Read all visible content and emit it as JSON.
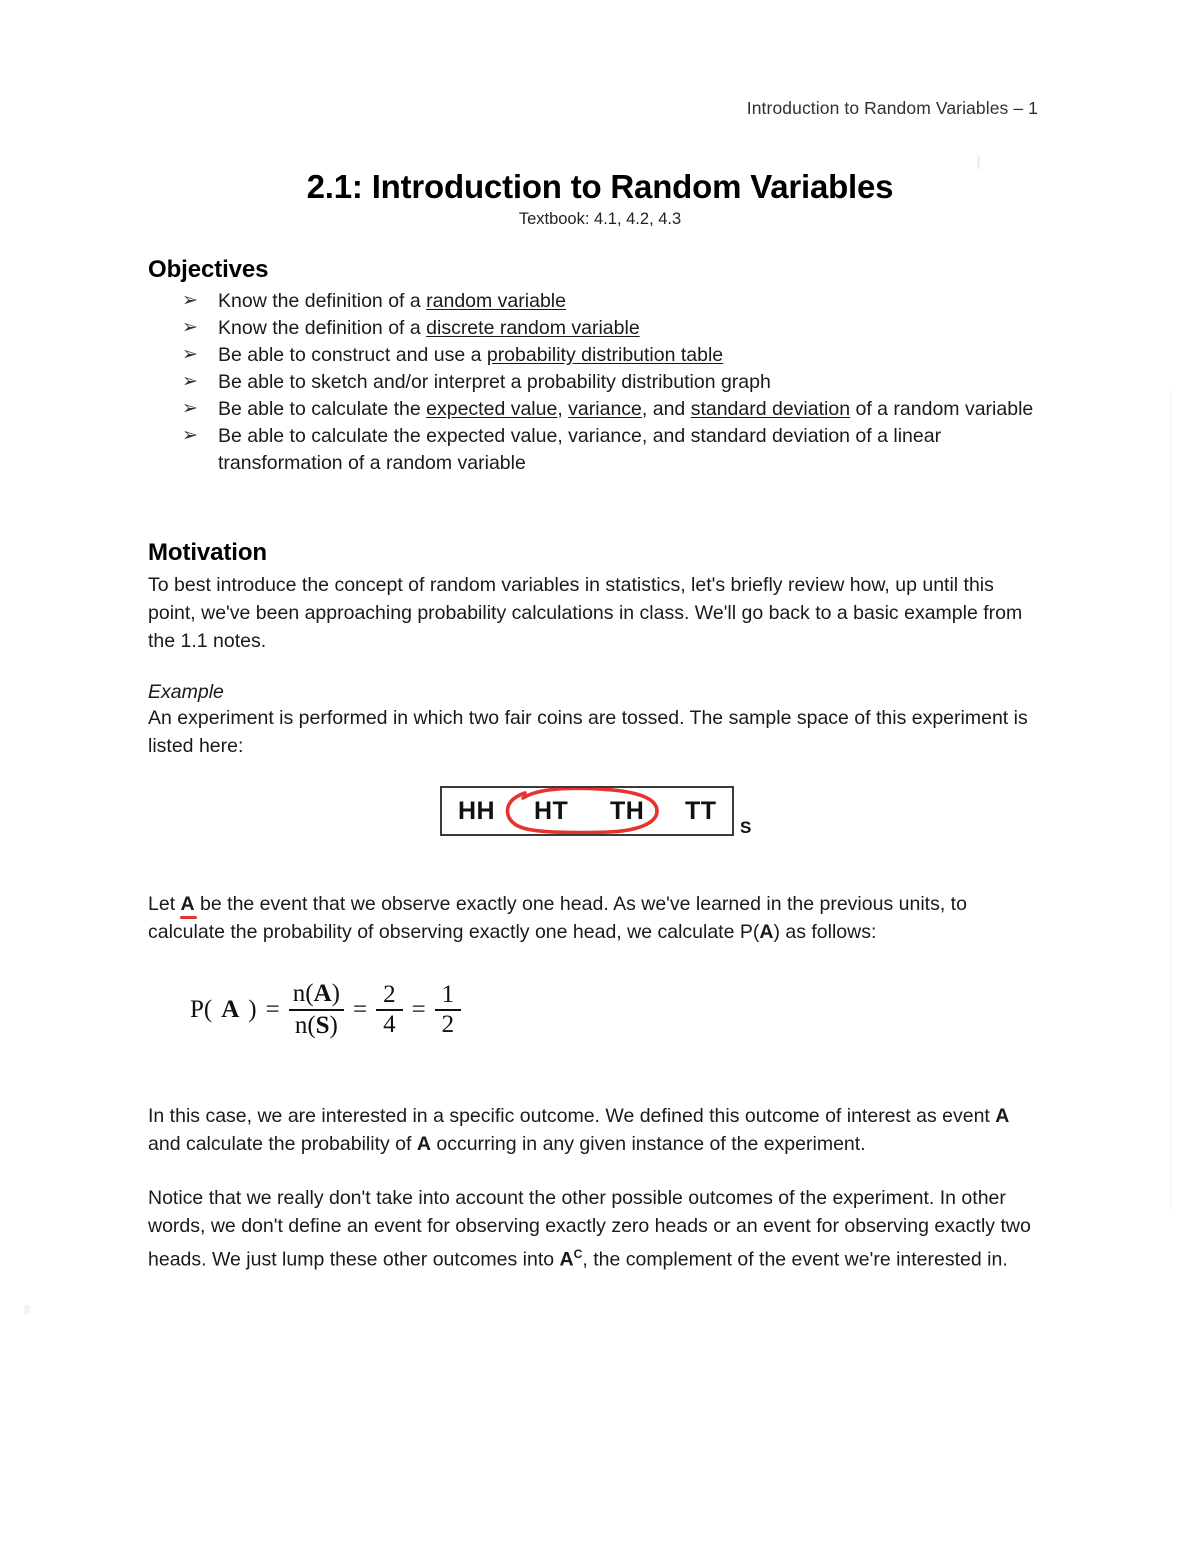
{
  "header": {
    "running_head": "Introduction to Random Variables – 1"
  },
  "title": {
    "main": "2.1: Introduction to Random Variables",
    "subtitle": "Textbook: 4.1, 4.2, 4.3"
  },
  "objectives": {
    "heading": "Objectives",
    "bullet_glyph": "➢",
    "items": [
      {
        "pre": "Know the definition of a ",
        "underlined": "random variable",
        "post": ""
      },
      {
        "pre": "Know the definition of a ",
        "underlined": "discrete random variable",
        "post": ""
      },
      {
        "pre": "Be able to construct and use a ",
        "underlined": "probability distribution table",
        "post": ""
      },
      {
        "pre": "Be able to sketch and/or interpret a probability distribution graph",
        "underlined": "",
        "post": ""
      },
      {
        "pre": "Be able to calculate the ",
        "underlined": "expected value",
        "mid1": ", ",
        "underlined2": "variance",
        "mid2": ", and ",
        "underlined3": "standard deviation",
        "post": " of a random variable"
      },
      {
        "pre": "Be able to calculate the expected value, variance, and standard deviation of a linear transformation of a random variable",
        "underlined": "",
        "post": ""
      }
    ]
  },
  "motivation": {
    "heading": "Motivation",
    "paragraph": "To best introduce the concept of random variables in statistics, let's briefly review how, up until this point, we've been approaching probability calculations in class. We'll go back to a basic example from the 1.1 notes.",
    "example_label": "Example",
    "example_intro": "An experiment is performed in which two fair coins are tossed. The sample space of this experiment is listed here:"
  },
  "sample_space": {
    "outcomes": [
      "HH",
      "HT",
      "TH",
      "TT"
    ],
    "subscript": "S",
    "annotation_color": "#e8322d",
    "circled_outcomes": [
      "HT",
      "TH"
    ]
  },
  "event_a": {
    "pre": "Let ",
    "marked": "A",
    "post": " be the event that we observe exactly one head. As we've learned in the previous units, to calculate the probability of observing exactly one head, we calculate P(",
    "post_bold": "A",
    "post_tail": ") as follows:"
  },
  "formula": {
    "lhs_p": "P(",
    "lhs_a": "A",
    "lhs_close": ")",
    "eq1": "=",
    "frac1_num_pre": "n(",
    "frac1_num_var": "A",
    "frac1_num_post": ")",
    "frac1_den_pre": "n(",
    "frac1_den_var": "S",
    "frac1_den_post": ")",
    "eq2": "=",
    "frac2_num": "2",
    "frac2_den": "4",
    "eq3": "=",
    "frac3_num": "1",
    "frac3_den": "2"
  },
  "closing": {
    "paragraph1_a": "In this case, we are interested in a specific outcome. We defined this outcome of interest as event ",
    "paragraph1_bold1": "A",
    "paragraph1_b": " and calculate the probability of ",
    "paragraph1_bold2": "A",
    "paragraph1_c": " occurring in any given instance of the experiment.",
    "paragraph2_a": "Notice that we really don't take into account the other possible outcomes of the experiment. In other words, we don't define an event for observing exactly zero heads or an event for observing exactly two heads. We just lump these other outcomes into ",
    "paragraph2_bold": "A",
    "paragraph2_sup": "C",
    "paragraph2_b": ", the complement of the event we're interested in."
  }
}
